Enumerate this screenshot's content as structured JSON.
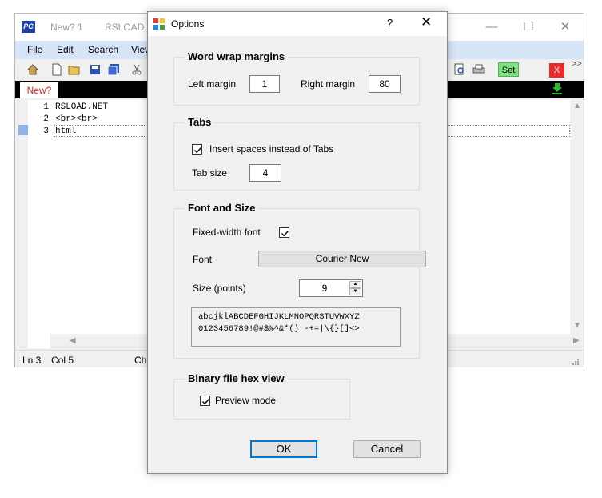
{
  "editor": {
    "title_left": "New? 1",
    "title_mid": "RSLOAD.N",
    "icon_text": "PC",
    "window_controls": [
      "—",
      "☐",
      "✕"
    ],
    "menu": [
      "File",
      "Edit",
      "Search",
      "View"
    ],
    "toolbar": {
      "set_label": "Set",
      "close_label": "X",
      "more": ">>"
    },
    "tab_label": "New?",
    "lines": [
      {
        "num": "1",
        "text": "RSLOAD.NET"
      },
      {
        "num": "2",
        "text": "<br><br>"
      },
      {
        "num": "3",
        "text": "html"
      }
    ],
    "status": {
      "line": "Ln 3",
      "col": "Col 5",
      "extra": "Cha"
    }
  },
  "dialog": {
    "title": "Options",
    "help": "?",
    "close": "✕",
    "word_wrap": {
      "title": "Word wrap margins",
      "left_label": "Left margin",
      "left_value": "1",
      "right_label": "Right margin",
      "right_value": "80"
    },
    "tabs": {
      "title": "Tabs",
      "insert_spaces_label": "Insert spaces instead of Tabs",
      "insert_spaces_checked": true,
      "tab_size_label": "Tab size",
      "tab_size_value": "4"
    },
    "font_size": {
      "title": "Font and Size",
      "fixed_width_label": "Fixed-width font",
      "fixed_width_checked": true,
      "font_label": "Font",
      "font_value": "Courier New",
      "size_label": "Size (points)",
      "size_value": "9",
      "preview_line1": "abcjklABCDEFGHIJKLMNOPQRSTUVWXYZ",
      "preview_line2": "0123456789!@#$%^&*()_-+=|\\{}[]<>"
    },
    "binary": {
      "title": "Binary file hex view",
      "preview_mode_label": "Preview mode",
      "preview_mode_checked": true
    },
    "ok_label": "OK",
    "cancel_label": "Cancel"
  }
}
